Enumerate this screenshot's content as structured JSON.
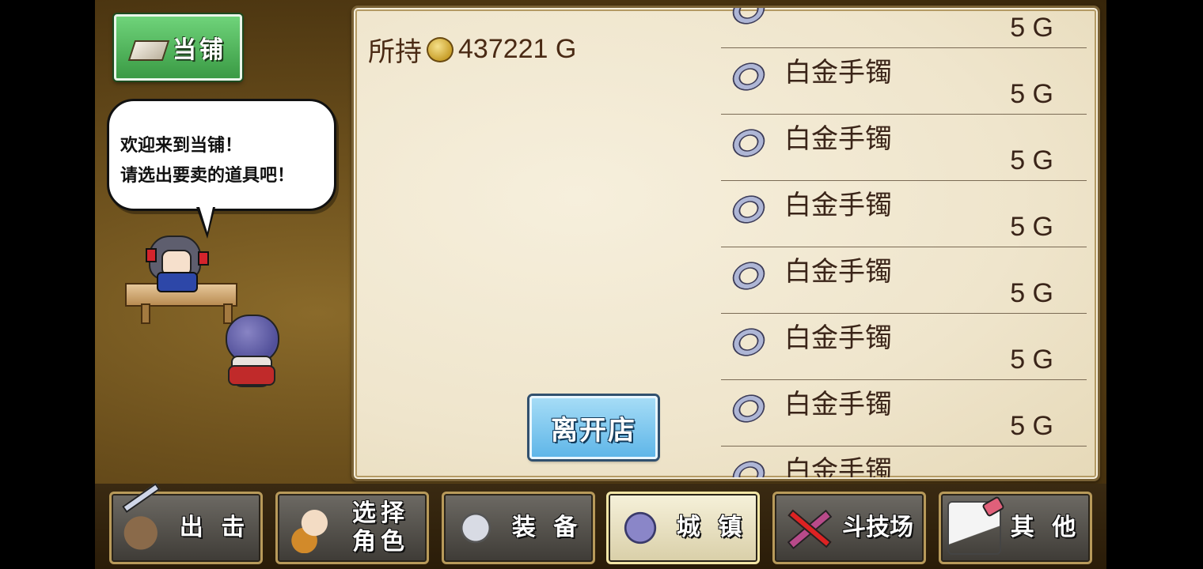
{
  "shop": {
    "title": "当铺"
  },
  "bubble": {
    "line1": "欢迎来到当铺！",
    "line2": "请选出要卖的道具吧！"
  },
  "money": {
    "label": "所持",
    "amount": "437221 G"
  },
  "leave_button": "离开店",
  "items": [
    {
      "name": "",
      "price": "5 G"
    },
    {
      "name": "白金手镯",
      "price": "5 G"
    },
    {
      "name": "白金手镯",
      "price": "5 G"
    },
    {
      "name": "白金手镯",
      "price": "5 G"
    },
    {
      "name": "白金手镯",
      "price": "5 G"
    },
    {
      "name": "白金手镯",
      "price": "5 G"
    },
    {
      "name": "白金手镯",
      "price": "5 G"
    },
    {
      "name": "白金手镯",
      "price": ""
    }
  ],
  "nav": [
    {
      "label": "出 击",
      "icon": "sword-bag-icon",
      "active": false
    },
    {
      "label": "选择\n角色",
      "icon": "character-icon",
      "active": false
    },
    {
      "label": "装 备",
      "icon": "armor-icon",
      "active": false
    },
    {
      "label": "城 镇",
      "icon": "town-icon",
      "active": true
    },
    {
      "label": "斗技场",
      "icon": "crossed-swords-icon",
      "active": false
    },
    {
      "label": "其 他",
      "icon": "scroll-icon",
      "active": false
    }
  ],
  "colors": {
    "accent_green": "#3a9a44",
    "accent_blue": "#5fb6e8",
    "parchment": "#efe5cc"
  }
}
